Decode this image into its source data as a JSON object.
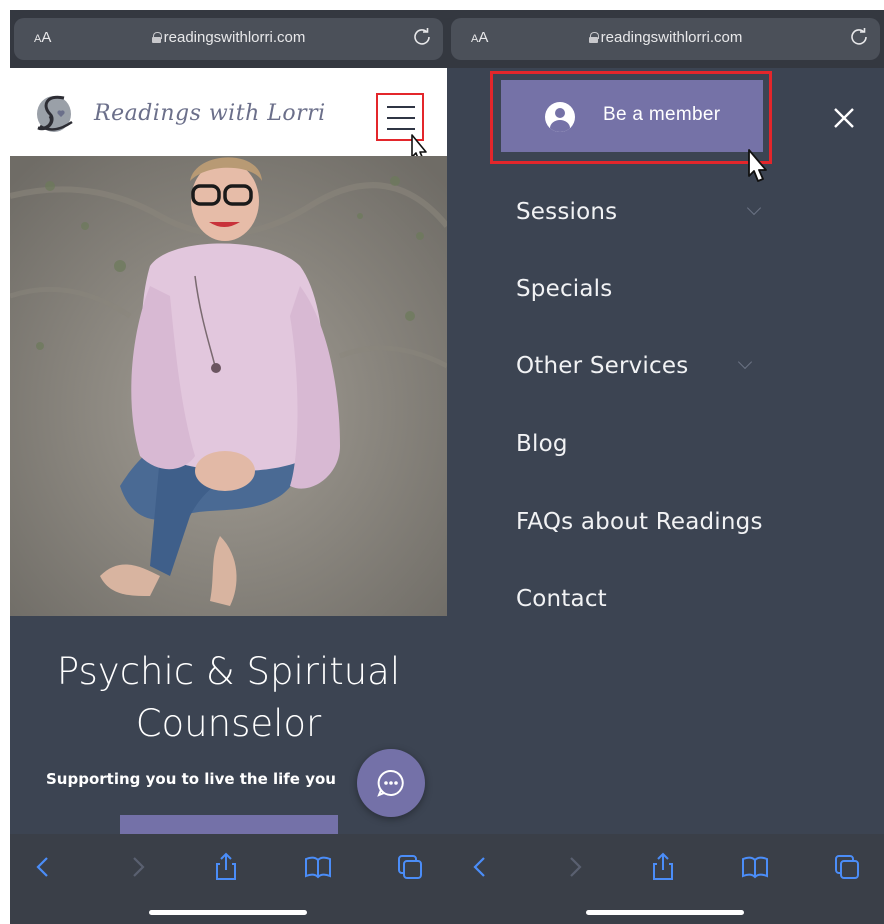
{
  "browser": {
    "text_size_label": "AA",
    "url": "readingswithlorri.com"
  },
  "site": {
    "logo_text": "Readings with Lorri",
    "headline_line1": "Psychic & Spiritual",
    "headline_line2": "Counselor",
    "subheadline": "Supporting you to live the life you"
  },
  "menu": {
    "member_label": "Be a member",
    "items": [
      {
        "label": "Sessions",
        "has_submenu": true
      },
      {
        "label": "Specials",
        "has_submenu": false
      },
      {
        "label": "Other Services",
        "has_submenu": true
      },
      {
        "label": "Blog",
        "has_submenu": false
      },
      {
        "label": "FAQs about Readings",
        "has_submenu": false
      },
      {
        "label": "Contact",
        "has_submenu": false
      }
    ]
  },
  "colors": {
    "accent": "#7471a8",
    "panel": "#3c4452",
    "highlight": "#e3262b"
  },
  "icons": [
    "lock-icon",
    "reload-icon",
    "hamburger-menu-icon",
    "chat-icon",
    "close-icon",
    "user-avatar-icon",
    "back-icon",
    "forward-icon",
    "share-icon",
    "bookmarks-icon",
    "tabs-icon"
  ]
}
